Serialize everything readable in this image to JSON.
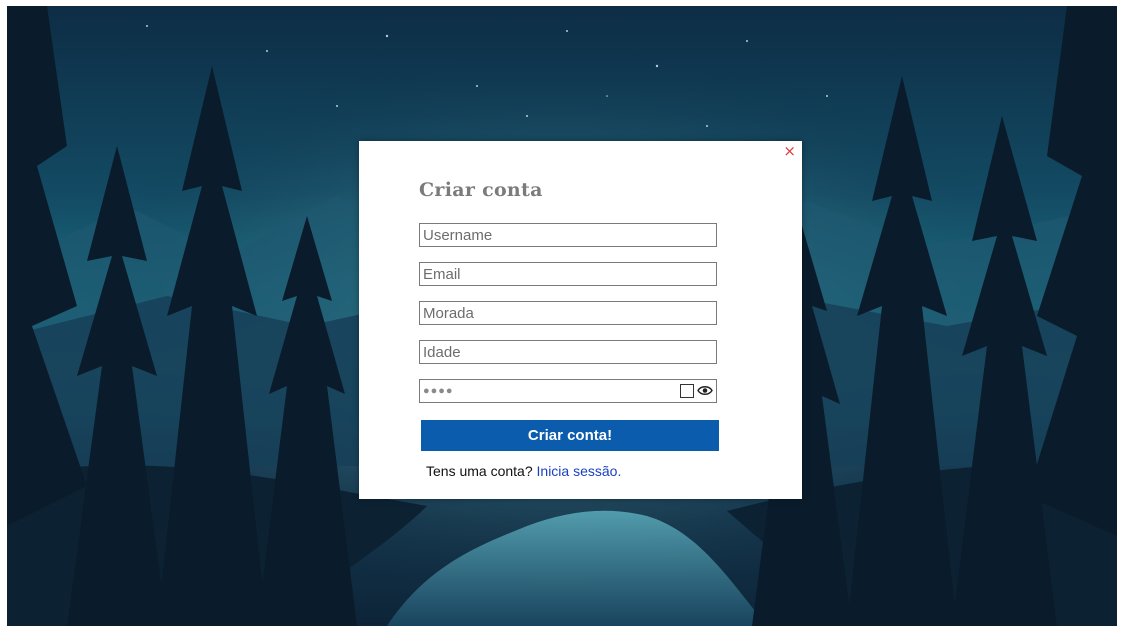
{
  "dialog": {
    "title": "Criar conta",
    "close_symbol": "×",
    "fields": {
      "username_placeholder": "Username",
      "email_placeholder": "Email",
      "morada_placeholder": "Morada",
      "idade_placeholder": "Idade",
      "password_masked": "●●●●"
    },
    "submit_label": "Criar conta!",
    "footer": {
      "prompt": "Tens uma conta?",
      "link": "Inicia sessão."
    }
  },
  "icons": {
    "close": "close-icon",
    "show_password": "eye-icon"
  },
  "colors": {
    "accent_button": "#0b5cad",
    "link": "#1a3fc2",
    "close": "#e0393e",
    "title": "#7b7b7b"
  }
}
